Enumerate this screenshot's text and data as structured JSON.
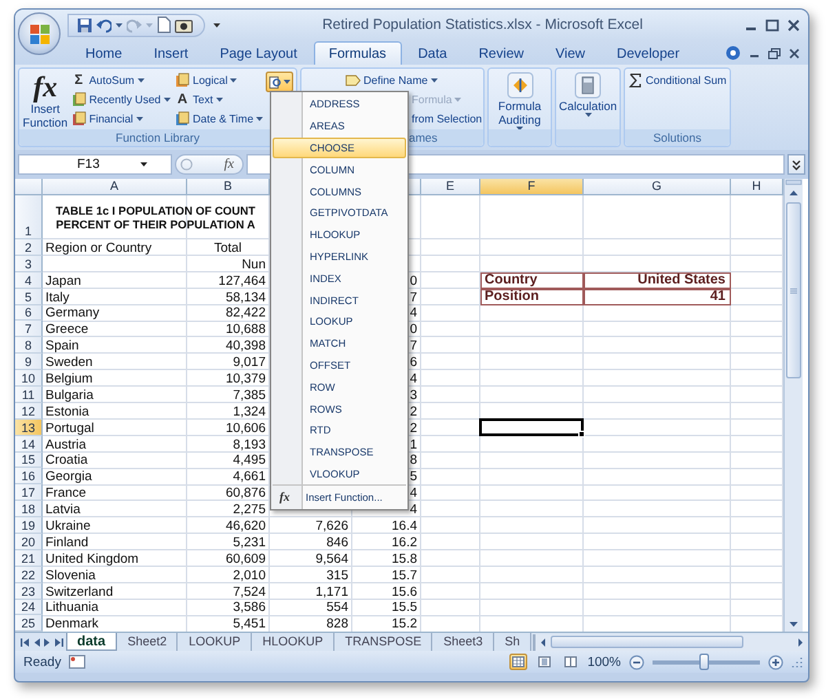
{
  "window": {
    "title": "Retired Population Statistics.xlsx - Microsoft Excel"
  },
  "ribbon_tabs": [
    {
      "label": "Home",
      "selected": false
    },
    {
      "label": "Insert",
      "selected": false
    },
    {
      "label": "Page Layout",
      "selected": false
    },
    {
      "label": "Formulas",
      "selected": true
    },
    {
      "label": "Data",
      "selected": false
    },
    {
      "label": "Review",
      "selected": false
    },
    {
      "label": "View",
      "selected": false
    },
    {
      "label": "Developer",
      "selected": false
    }
  ],
  "ribbon": {
    "function_library": {
      "label": "Function Library",
      "insert_function": {
        "glyph": "fx",
        "label": "Insert Function"
      },
      "items": [
        {
          "label": "AutoSum",
          "glyph": "Σ"
        },
        {
          "label": "Recently Used"
        },
        {
          "label": "Financial"
        },
        {
          "label": "Logical"
        },
        {
          "label": "Text",
          "glyph": "A"
        },
        {
          "label": "Date & Time"
        }
      ],
      "lookup_expanded": true
    },
    "defined_names": {
      "label": "ames",
      "items": [
        {
          "label": "Define Name",
          "disabled": false
        },
        {
          "label": "Formula",
          "disabled": true
        },
        {
          "label": "from Selection",
          "disabled": false
        }
      ]
    },
    "formula_auditing": {
      "label": "Formula Auditing"
    },
    "calculation": {
      "label": "Calculation"
    },
    "solutions": {
      "label": "Solutions",
      "items": [
        {
          "label": "Conditional Sum"
        }
      ]
    }
  },
  "formula_bar": {
    "name_box": "F13",
    "function_label": "fx"
  },
  "function_menu": {
    "items": [
      {
        "kind": "function",
        "label": "ADDRESS",
        "selected": false
      },
      {
        "kind": "function",
        "label": "AREAS",
        "selected": false
      },
      {
        "kind": "function",
        "label": "CHOOSE",
        "selected": true
      },
      {
        "kind": "function",
        "label": "COLUMN",
        "selected": false
      },
      {
        "kind": "function",
        "label": "COLUMNS",
        "selected": false
      },
      {
        "kind": "function",
        "label": "GETPIVOTDATA",
        "selected": false
      },
      {
        "kind": "function",
        "label": "HLOOKUP",
        "selected": false
      },
      {
        "kind": "function",
        "label": "HYPERLINK",
        "selected": false
      },
      {
        "kind": "function",
        "label": "INDEX",
        "selected": false
      },
      {
        "kind": "function",
        "label": "INDIRECT",
        "selected": false
      },
      {
        "kind": "function",
        "label": "LOOKUP",
        "selected": false
      },
      {
        "kind": "function",
        "label": "MATCH",
        "selected": false
      },
      {
        "kind": "function",
        "label": "OFFSET",
        "selected": false
      },
      {
        "kind": "function",
        "label": "ROW",
        "selected": false
      },
      {
        "kind": "function",
        "label": "ROWS",
        "selected": false
      },
      {
        "kind": "function",
        "label": "RTD",
        "selected": false
      },
      {
        "kind": "function",
        "label": "TRANSPOSE",
        "selected": false
      },
      {
        "kind": "function",
        "label": "VLOOKUP",
        "selected": false
      },
      {
        "kind": "command",
        "glyph": "fx",
        "label": "Insert Function...",
        "selected": false
      }
    ]
  },
  "sheet": {
    "columns": [
      {
        "label": "A",
        "selected": false
      },
      {
        "label": "B",
        "selected": false
      },
      {},
      {
        "selected": false
      },
      {
        "label": "E",
        "selected": false
      },
      {
        "label": "F",
        "selected": true
      },
      {
        "label": "G",
        "selected": false
      },
      {
        "label": "H",
        "selected": false
      }
    ],
    "rows": [
      {
        "number": "1",
        "kind": "title",
        "a": "TABLE 1c I POPULATION OF COUNT\nPERCENT OF THEIR POPULATION A",
        "selected": false
      },
      {
        "number": "2",
        "kind": "heading",
        "a": "Region or Country",
        "b": "Total",
        "selected": false
      },
      {
        "number": "3",
        "kind": "data",
        "b": "Nun",
        "selected": false
      },
      {
        "number": "4",
        "kind": "data",
        "a": "Japan",
        "b": "127,464",
        "d": "0",
        "f": "Country",
        "g": "United States",
        "selected": false
      },
      {
        "number": "5",
        "kind": "data",
        "a": "Italy",
        "b": "58,134",
        "d": "7",
        "f": "Position",
        "g": "41",
        "selected": false
      },
      {
        "number": "6",
        "kind": "data",
        "a": "Germany",
        "b": "82,422",
        "d": "4",
        "selected": false
      },
      {
        "number": "7",
        "kind": "data",
        "a": "Greece",
        "b": "10,688",
        "d": "0",
        "selected": false
      },
      {
        "number": "8",
        "kind": "data",
        "a": "Spain",
        "b": "40,398",
        "d": "7",
        "selected": false
      },
      {
        "number": "9",
        "kind": "data",
        "a": "Sweden",
        "b": "9,017",
        "d": "6",
        "selected": false
      },
      {
        "number": "10",
        "kind": "data",
        "a": "Belgium",
        "b": "10,379",
        "d": "4",
        "selected": false
      },
      {
        "number": "11",
        "kind": "data",
        "a": "Bulgaria",
        "b": "7,385",
        "d": "3",
        "selected": false
      },
      {
        "number": "12",
        "kind": "data",
        "a": "Estonia",
        "b": "1,324",
        "d": "2",
        "selected": false
      },
      {
        "number": "13",
        "kind": "data",
        "a": "Portugal",
        "b": "10,606",
        "d": "2",
        "selected": true
      },
      {
        "number": "14",
        "kind": "data",
        "a": "Austria",
        "b": "8,193",
        "d": "1",
        "selected": false
      },
      {
        "number": "15",
        "kind": "data",
        "a": "Croatia",
        "b": "4,495",
        "d": "8",
        "selected": false
      },
      {
        "number": "16",
        "kind": "data",
        "a": "Georgia",
        "b": "4,661",
        "d": "5",
        "selected": false
      },
      {
        "number": "17",
        "kind": "data",
        "a": "France",
        "b": "60,876",
        "d": "4",
        "selected": false
      },
      {
        "number": "18",
        "kind": "data",
        "a": "Latvia",
        "b": "2,275",
        "d": "4",
        "selected": false
      },
      {
        "number": "19",
        "kind": "data",
        "a": "Ukraine",
        "b": "46,620",
        "c": "7,626",
        "d": "16.4",
        "selected": false
      },
      {
        "number": "20",
        "kind": "data",
        "a": "Finland",
        "b": "5,231",
        "c": "846",
        "d": "16.2",
        "selected": false
      },
      {
        "number": "21",
        "kind": "data",
        "a": "United Kingdom",
        "b": "60,609",
        "c": "9,564",
        "d": "15.8",
        "selected": false
      },
      {
        "number": "22",
        "kind": "data",
        "a": "Slovenia",
        "b": "2,010",
        "c": "315",
        "d": "15.7",
        "selected": false
      },
      {
        "number": "23",
        "kind": "data",
        "a": "Switzerland",
        "b": "7,524",
        "c": "1,171",
        "d": "15.6",
        "selected": false
      },
      {
        "number": "24",
        "kind": "data",
        "a": "Lithuania",
        "b": "3,586",
        "c": "554",
        "d": "15.5",
        "selected": false
      },
      {
        "number": "25",
        "kind": "data",
        "a": "Denmark",
        "b": "5,451",
        "c": "828",
        "d": "15.2",
        "selected": false
      }
    ]
  },
  "sheet_tabs": [
    {
      "label": "data",
      "selected": true
    },
    {
      "label": "Sheet2",
      "selected": false
    },
    {
      "label": "LOOKUP",
      "selected": false
    },
    {
      "label": "HLOOKUP",
      "selected": false
    },
    {
      "label": "TRANSPOSE",
      "selected": false
    },
    {
      "label": "Sheet3",
      "selected": false
    },
    {
      "label": "Sh",
      "selected": false
    }
  ],
  "status_bar": {
    "status": "Ready",
    "views": [
      {
        "selected": true
      },
      {
        "selected": false
      },
      {
        "selected": false
      }
    ],
    "zoom": "100%",
    "zoom_slider": {
      "level": 0.48
    }
  }
}
